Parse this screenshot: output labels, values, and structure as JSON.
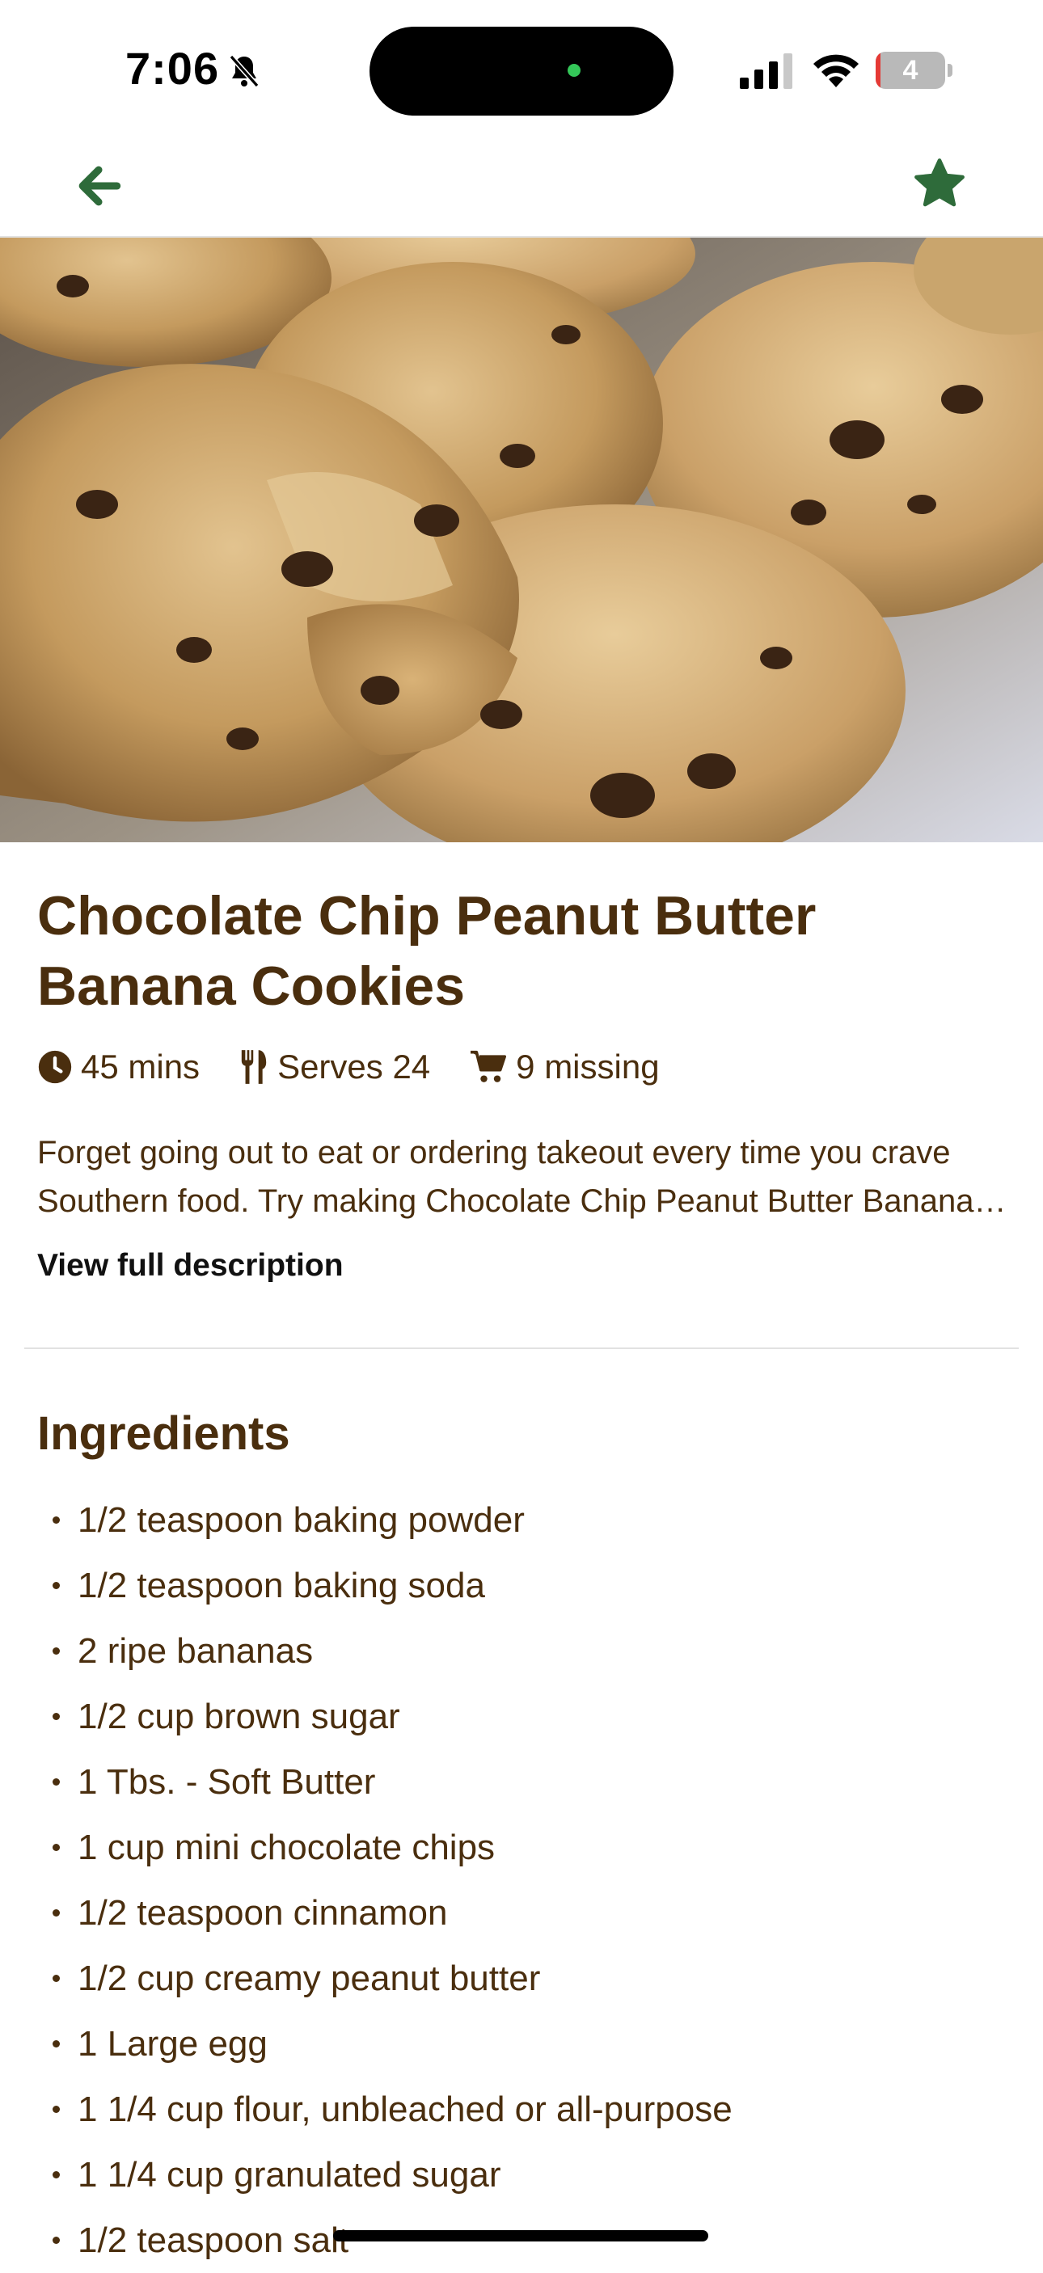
{
  "status_bar": {
    "time": "7:06",
    "battery_level": "4",
    "battery_fill_fraction": 0.04,
    "icons": [
      "bell-slash-icon",
      "signal-icon",
      "wifi-icon",
      "battery-icon"
    ]
  },
  "nav": {
    "back_icon": "arrow-left-icon",
    "favorite_icon": "star-icon",
    "accent_color": "#2e6b3a"
  },
  "recipe": {
    "title": "Chocolate Chip Peanut Butter Banana Cookies",
    "time": "45 mins",
    "serves": "Serves 24",
    "missing": "9 missing",
    "description": "Forget going out to eat or ordering takeout every time you crave Southern food. Try making Chocolate Chip Peanut Butter Banana Cookies at home.",
    "view_full_label": "View full description",
    "text_color": "#4a2e0e"
  },
  "ingredients": {
    "heading": "Ingredients",
    "items": [
      "1/2 teaspoon baking powder",
      "1/2 teaspoon baking soda",
      "2 ripe bananas",
      "1/2 cup brown sugar",
      "1 Tbs. - Soft Butter",
      "1 cup mini chocolate chips",
      "1/2 teaspoon cinnamon",
      "1/2 cup creamy peanut butter",
      "1 Large egg",
      "1 1/4 cup flour, unbleached or all-purpose",
      "1 1/4 cup granulated sugar",
      "1/2 teaspoon salt"
    ]
  }
}
